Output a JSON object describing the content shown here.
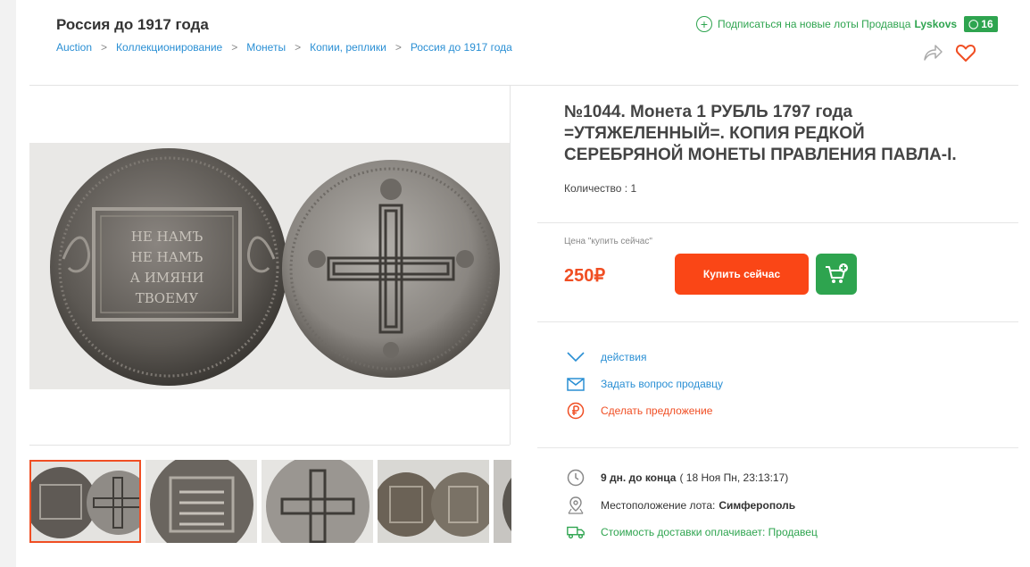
{
  "header": {
    "title": "Россия до 1917 года",
    "breadcrumbs": [
      "Auction",
      "Коллекционирование",
      "Монеты",
      "Копии, реплики",
      "Россия до 1917 года"
    ],
    "breadcrumb_separator": ">",
    "subscribe_label": "Подписаться на новые лоты Продавца",
    "seller_name": "Lyskovs",
    "seller_rating": "16"
  },
  "lot": {
    "title": "№1044. Монета 1 РУБЛЬ 1797 года =УТЯЖЕЛЕННЫЙ=. КОПИЯ РЕДКОЙ СЕРЕБРЯНОЙ МОНЕТЫ ПРАВЛЕНИЯ ПАВЛА-I.",
    "quantity_label": "Количество : 1",
    "price_label": "Цена \"купить сейчас\"",
    "price": "250₽",
    "buy_button": "Купить сейчас"
  },
  "coin_inscriptions": {
    "reverse_lines": [
      "НЕ НАМЪ",
      "НЕ НАМЪ",
      "А ИМЯНИ",
      "ТВОЕМУ"
    ]
  },
  "actions": [
    {
      "label": "действия",
      "icon": "chevron-down-icon"
    },
    {
      "label": "Задать вопрос продавцу",
      "icon": "envelope-icon"
    },
    {
      "label": "Сделать предложение",
      "icon": "ruble-circle-icon"
    }
  ],
  "info": {
    "time_left": "9 дн. до конца",
    "end_date": "( 18 Ноя Пн, 23:13:17)",
    "location_label": "Местоположение лота:",
    "location_value": "Симферополь",
    "delivery_label": "Стоимость доставки оплачивает: Продавец"
  },
  "colors": {
    "accent_orange": "#fa4616",
    "link_blue": "#2a8fd4",
    "green": "#2ea44f"
  }
}
